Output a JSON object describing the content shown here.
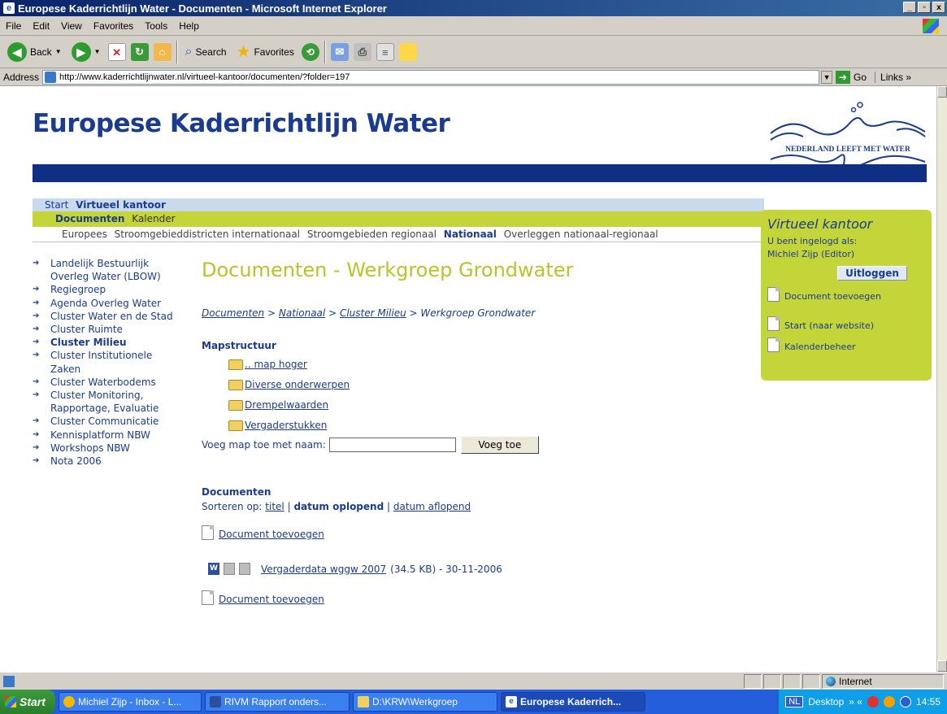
{
  "window": {
    "title": "Europese Kaderrichtlijn Water - Documenten - Microsoft Internet Explorer",
    "controls": [
      "_",
      "▫",
      "x"
    ]
  },
  "menu": [
    "File",
    "Edit",
    "View",
    "Favorites",
    "Tools",
    "Help"
  ],
  "toolbar": {
    "back": "Back",
    "search": "Search",
    "favorites": "Favorites"
  },
  "address": {
    "label": "Address",
    "url": "http://www.kaderrichtlijnwater.nl/virtueel-kantoor/documenten/?folder=197",
    "go": "Go",
    "links": "Links »"
  },
  "site": {
    "title": "Europese Kaderrichtlijn Water",
    "logo_text": "NEDERLAND LEEFT MET WATER"
  },
  "nav1": {
    "start": "Start",
    "active": "Virtueel kantoor"
  },
  "nav2": {
    "active": "Documenten",
    "other": "Kalender"
  },
  "nav3": [
    {
      "label": "Europees",
      "active": false
    },
    {
      "label": "Stroomgebieddistricten internationaal",
      "active": false
    },
    {
      "label": "Stroomgebieden regionaal",
      "active": false
    },
    {
      "label": "Nationaal",
      "active": true
    },
    {
      "label": "Overleggen nationaal-regionaal",
      "active": false
    }
  ],
  "leftnav": [
    {
      "label": "Landelijk Bestuurlijk Overleg Water (LBOW)",
      "active": false
    },
    {
      "label": "Regiegroep",
      "active": false
    },
    {
      "label": "Agenda Overleg Water",
      "active": false
    },
    {
      "label": "Cluster Water en de Stad",
      "active": false
    },
    {
      "label": "Cluster Ruimte",
      "active": false
    },
    {
      "label": "Cluster Milieu",
      "active": true
    },
    {
      "label": "Cluster Institutionele Zaken",
      "active": false
    },
    {
      "label": "Cluster Waterbodems",
      "active": false
    },
    {
      "label": "Cluster Monitoring, Rapportage, Evaluatie",
      "active": false
    },
    {
      "label": "Cluster Communicatie",
      "active": false
    },
    {
      "label": "Kennisplatform NBW",
      "active": false
    },
    {
      "label": "Workshops NBW",
      "active": false
    },
    {
      "label": "Nota 2006",
      "active": false
    }
  ],
  "main": {
    "heading": "Documenten - Werkgroep Grondwater",
    "breadcrumb": {
      "c1": "Documenten",
      "c2": "Nationaal",
      "c3": "Cluster Milieu",
      "current": "Werkgroep Grondwater",
      "sep": ">"
    },
    "map_heading": "Mapstructuur",
    "folders": [
      ".. map hoger",
      "Diverse onderwerpen",
      "Drempelwaarden",
      "Vergaderstukken"
    ],
    "add_folder_label": "Voeg map toe met naam:",
    "add_folder_button": "Voeg toe",
    "docs_heading": "Documenten",
    "sort_label": "Sorteren op:",
    "sort_title": "titel",
    "sort_asc": "datum oplopend",
    "sort_desc": "datum aflopend",
    "sort_sep": "|",
    "add_document": "Document toevoegen",
    "document": {
      "name": "Vergaderdata wggw 2007",
      "meta": "(34.5 KB) - 30-11-2006"
    }
  },
  "rightbox": {
    "title": "Virtueel kantoor",
    "login_label": "U bent ingelogd als:",
    "user": "Michiel Zijp (Editor)",
    "logout": "Uitloggen",
    "add_document": "Document toevoegen",
    "start": "Start (naar website)",
    "calendar": "Kalenderbeheer"
  },
  "status": {
    "zone": "Internet"
  },
  "taskbar": {
    "start": "Start",
    "tasks": [
      "Michiel Zijp - Inbox - L...",
      "RIVM Rapport onders...",
      "D:\\KRW\\Werkgroep",
      "Europese Kaderrich..."
    ],
    "lang": "NL",
    "desktop": "Desktop",
    "chevrons": "»  «",
    "clock": "14:55"
  },
  "colors": {
    "brand_blue": "#1a3b8f",
    "lime": "#c4d53a",
    "heading_green": "#b8c42a"
  }
}
